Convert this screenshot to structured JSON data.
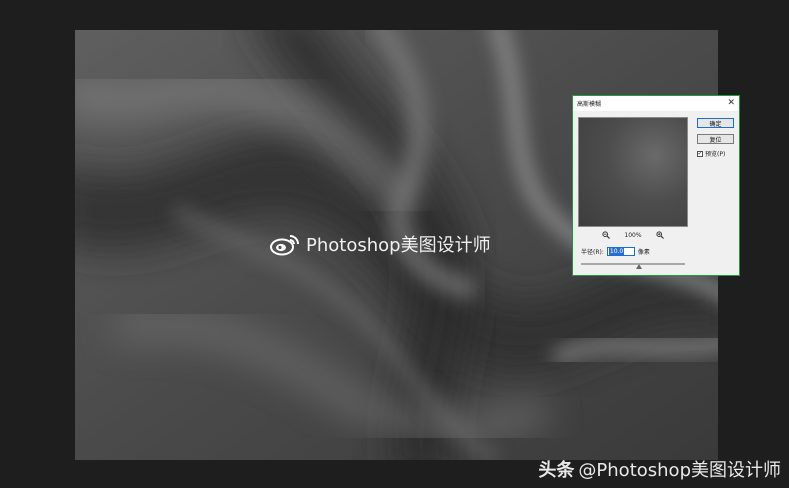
{
  "watermark": {
    "text": "Photoshop美图设计师",
    "logo_icon": "weibo-icon"
  },
  "credit": {
    "brand": "头条",
    "handle": "@Photoshop美图设计师"
  },
  "dialog": {
    "title": "高斯模糊",
    "ok_label": "确定",
    "reset_label": "复位",
    "preview_label": "预览(P)",
    "preview_checked": true,
    "zoom_level": "100%",
    "zoom_out_icon": "zoom-out-icon",
    "zoom_in_icon": "zoom-in-icon",
    "radius_label": "半径(R):",
    "radius_value": "10.0",
    "radius_unit": "像素",
    "accent_color": "#1f9d3a"
  }
}
